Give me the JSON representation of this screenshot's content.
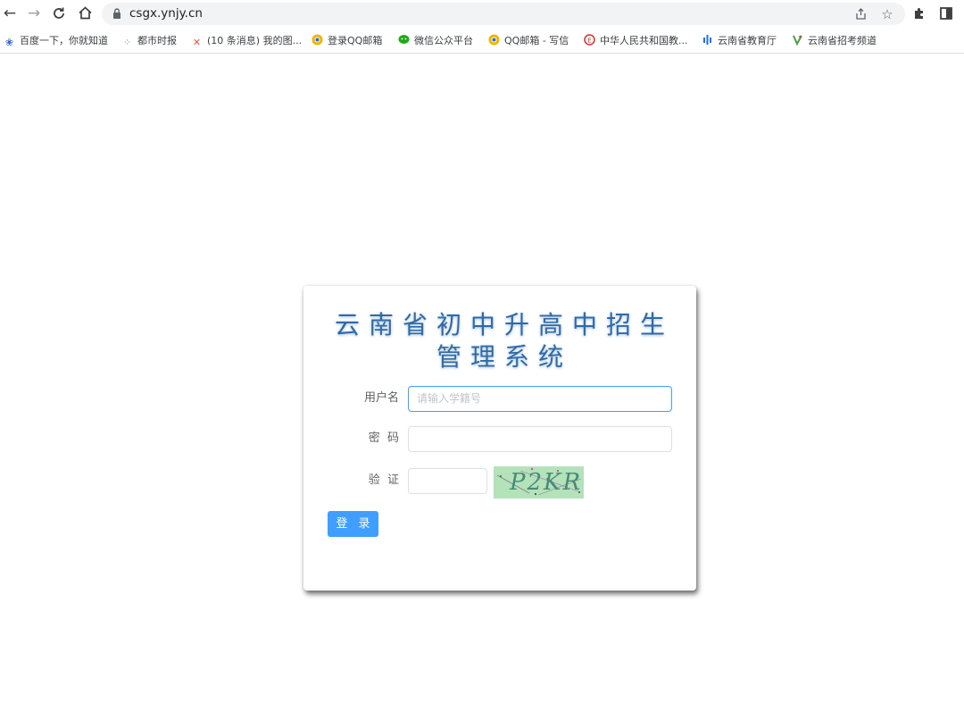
{
  "browser": {
    "url": "csgx.ynjy.cn",
    "nav": {
      "back_icon": "back-arrow-icon",
      "forward_icon": "forward-arrow-icon",
      "reload_icon": "reload-icon",
      "home_icon": "home-icon"
    },
    "bookmarks": [
      {
        "label": "百度一下，你就知道",
        "icon": "paw-icon",
        "color": "#3366cc"
      },
      {
        "label": "都市时报",
        "icon": "dots-icon",
        "color": "#5b8bd3"
      },
      {
        "label": "(10 条消息) 我的图...",
        "icon": "x-logo-icon",
        "color": "#e8553e"
      },
      {
        "label": "登录QQ邮箱",
        "icon": "chrome-icon",
        "color": "#f3b300"
      },
      {
        "label": "微信公众平台",
        "icon": "wechat-icon",
        "color": "#1aad19"
      },
      {
        "label": "QQ邮箱 - 写信",
        "icon": "chrome-icon",
        "color": "#f3b300"
      },
      {
        "label": "中华人民共和国教...",
        "icon": "emblem-icon",
        "color": "#d32f2f"
      },
      {
        "label": "云南省教育厅",
        "icon": "bars-icon",
        "color": "#1a73e8"
      },
      {
        "label": "云南省招考频道",
        "icon": "leaf-icon",
        "color": "#43a047"
      }
    ]
  },
  "login": {
    "title_line1": "云南省初中升高中招生",
    "title_line2": "管理系统",
    "username_label": "用户名",
    "username_placeholder": "请输入学籍号",
    "password_label": "密  码",
    "captcha_label": "验  证",
    "captcha_text": "P2KR",
    "login_button": "登 录"
  },
  "colors": {
    "accent": "#409eff",
    "title": "#2f6aa8",
    "captcha_bg": "#b4e2b9"
  }
}
